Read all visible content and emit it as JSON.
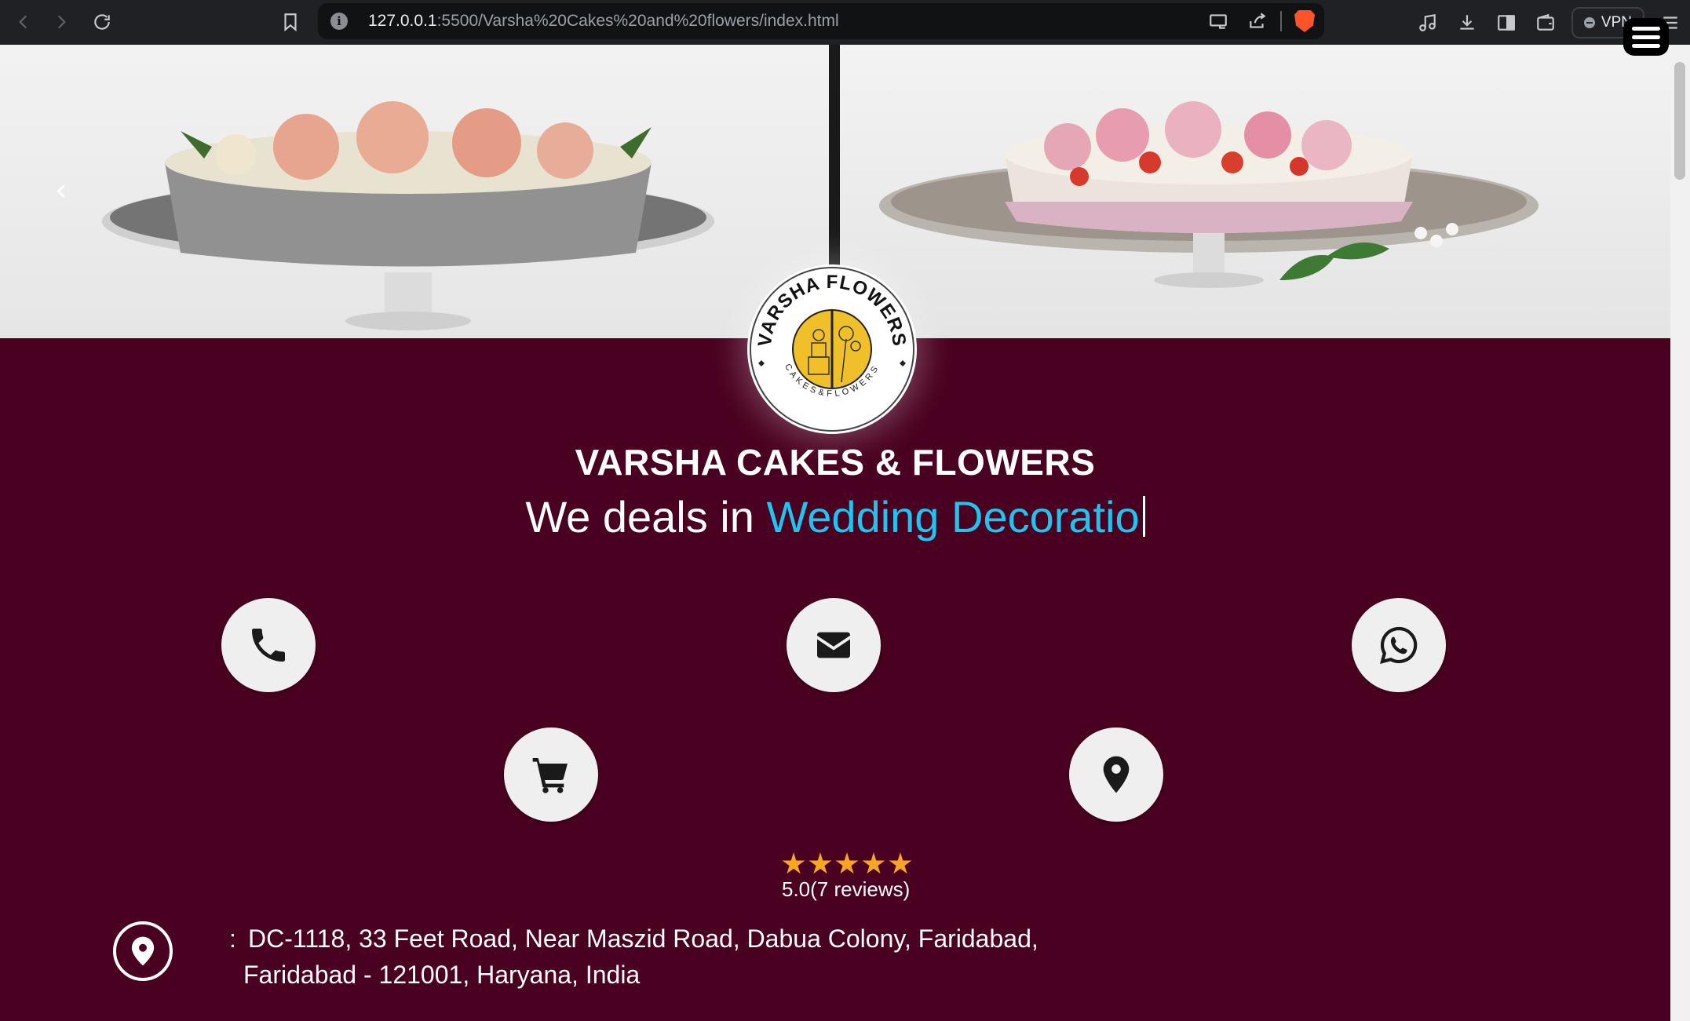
{
  "browser": {
    "url_host": "127.0.0.1",
    "url_path": ":5500/Varsha%20Cakes%20and%20flowers/index.html",
    "vpn_label": "VPN"
  },
  "hero": {
    "prev_glyph": "‹"
  },
  "logo": {
    "top_text": "VARSHA FLOWERS",
    "bottom_text": "CAKES&FLOWERS",
    "accent_color": "#f0c02a"
  },
  "header": {
    "title": "VARSHA CAKES & FLOWERS",
    "tagline_prefix": "We deals in ",
    "tagline_accent": "Wedding Decoratio"
  },
  "contacts": {
    "items": [
      {
        "name": "phone",
        "icon": "phone-icon"
      },
      {
        "name": "email",
        "icon": "mail-icon"
      },
      {
        "name": "whatsapp",
        "icon": "whatsapp-icon"
      },
      {
        "name": "shop",
        "icon": "cart-icon"
      },
      {
        "name": "location",
        "icon": "map-pin-icon"
      }
    ]
  },
  "rating": {
    "stars": 5,
    "text": "5.0(7 reviews)",
    "star_color": "#f5a623"
  },
  "address": {
    "separator": ":",
    "line1": "DC-1118, 33 Feet Road, Near Maszid Road, Dabua Colony, Faridabad,",
    "line2": "Faridabad - 121001, Haryana, India"
  },
  "colors": {
    "page_background": "#4a0020",
    "accent_text": "#1ec6ef"
  }
}
